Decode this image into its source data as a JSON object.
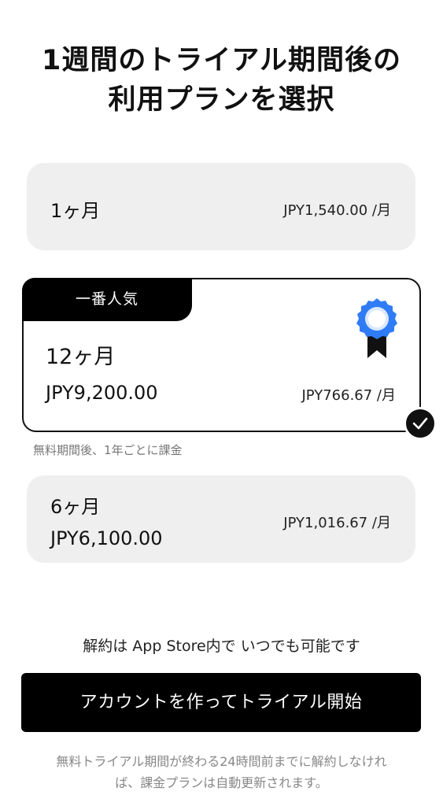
{
  "header": {
    "title_line1": "1週間のトライアル期間後の",
    "title_line2": "利用プランを選択"
  },
  "plans": {
    "monthly": {
      "name": "1ヶ月",
      "per_month": "JPY1,540.00 /月"
    },
    "yearly": {
      "badge": "一番人気",
      "name": "12ヶ月",
      "price": "JPY9,200.00",
      "per_month": "JPY766.67 /月",
      "selected": true,
      "note": "無料期間後、1年ごとに課金"
    },
    "half_year": {
      "name": "6ヶ月",
      "price": "JPY6,100.00",
      "per_month": "JPY1,016.67 /月"
    }
  },
  "footer": {
    "cancel_text": "解約は App Store内で いつでも可能です",
    "cta_label": "アカウントを作ってトライアル開始",
    "disclaimer_line1": "無料トライアル期間が終わる24時間前までに解約しなけれ",
    "disclaimer_line2": "ば、課金プランは自動更新されます。"
  },
  "colors": {
    "accent_blue": "#2f7cf6",
    "dark": "#000000",
    "card_gray": "#efefef"
  },
  "icons": {
    "award": "award-ribbon-icon",
    "check": "checkmark-icon"
  }
}
